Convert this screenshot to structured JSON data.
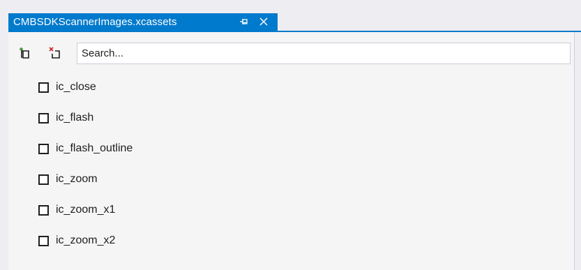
{
  "tab": {
    "title": "CMBSDKScannerImages.xcassets",
    "pin_icon": "pin-icon",
    "close_icon": "close-icon",
    "active_color": "#007acc"
  },
  "toolbar": {
    "add_icon": "add-asset-icon",
    "remove_icon": "remove-asset-icon",
    "search": {
      "placeholder": "Search...",
      "value": ""
    }
  },
  "assets": {
    "items": [
      {
        "label": "ic_close",
        "checked": false
      },
      {
        "label": "ic_flash",
        "checked": false
      },
      {
        "label": "ic_flash_outline",
        "checked": false
      },
      {
        "label": "ic_zoom",
        "checked": false
      },
      {
        "label": "ic_zoom_x1",
        "checked": false
      },
      {
        "label": "ic_zoom_x2",
        "checked": false
      }
    ]
  }
}
